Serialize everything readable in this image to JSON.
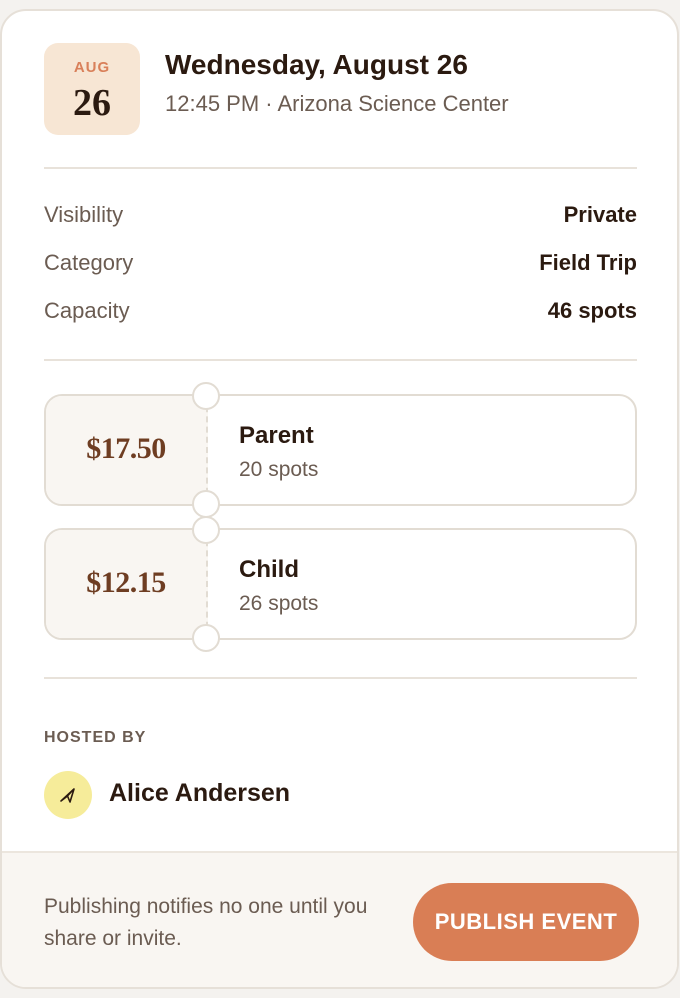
{
  "event": {
    "month": "AUG",
    "day": "26",
    "title": "Wednesday, August 26",
    "subtitle": "12:45 PM · Arizona Science Center"
  },
  "details": [
    {
      "label": "Visibility",
      "value": "Private"
    },
    {
      "label": "Category",
      "value": "Field Trip"
    },
    {
      "label": "Capacity",
      "value": "46 spots"
    }
  ],
  "tickets": [
    {
      "price": "$17.50",
      "name": "Parent",
      "spots": "20 spots"
    },
    {
      "price": "$12.15",
      "name": "Child",
      "spots": "26 spots"
    }
  ],
  "host": {
    "section_label": "HOSTED BY",
    "name": "Alice Andersen",
    "avatar_icon": "paper-plane-icon",
    "avatar_color": "#f6ec9a"
  },
  "footer": {
    "note": "Publishing notifies no one until you share or invite.",
    "publish_label": "PUBLISH EVENT"
  },
  "colors": {
    "accent": "#d97e55",
    "badge_bg": "#f7e6d4",
    "price_text": "#6e3d22"
  }
}
